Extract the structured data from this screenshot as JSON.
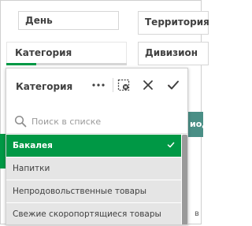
{
  "filters": {
    "day": {
      "label": "День"
    },
    "territory": {
      "label": "Территория"
    },
    "category": {
      "label": "Категория",
      "selected_fraction": 0.25
    },
    "division": {
      "label": "Дивизион"
    }
  },
  "background": {
    "side_text": "иод",
    "bottom_peek_text": "в"
  },
  "listbox": {
    "title": "Категория",
    "tools": {
      "more": "more-icon",
      "clear": "clear-selections-icon",
      "cancel": "close-icon",
      "confirm": "checkmark-icon"
    },
    "search": {
      "placeholder": "Поиск в списке",
      "value": ""
    },
    "items": [
      {
        "label": "Бакалея",
        "state": "selected"
      },
      {
        "label": "Напитки",
        "state": "alternative"
      },
      {
        "label": "Непродовольственные товары",
        "state": "alternative"
      },
      {
        "label": "Свежие скоропортящиеся товары",
        "state": "alternative"
      }
    ]
  },
  "colors": {
    "selected": "#009845",
    "alternative": "#e5e5e5",
    "text": "#404040",
    "teal": "#4a8f86"
  }
}
